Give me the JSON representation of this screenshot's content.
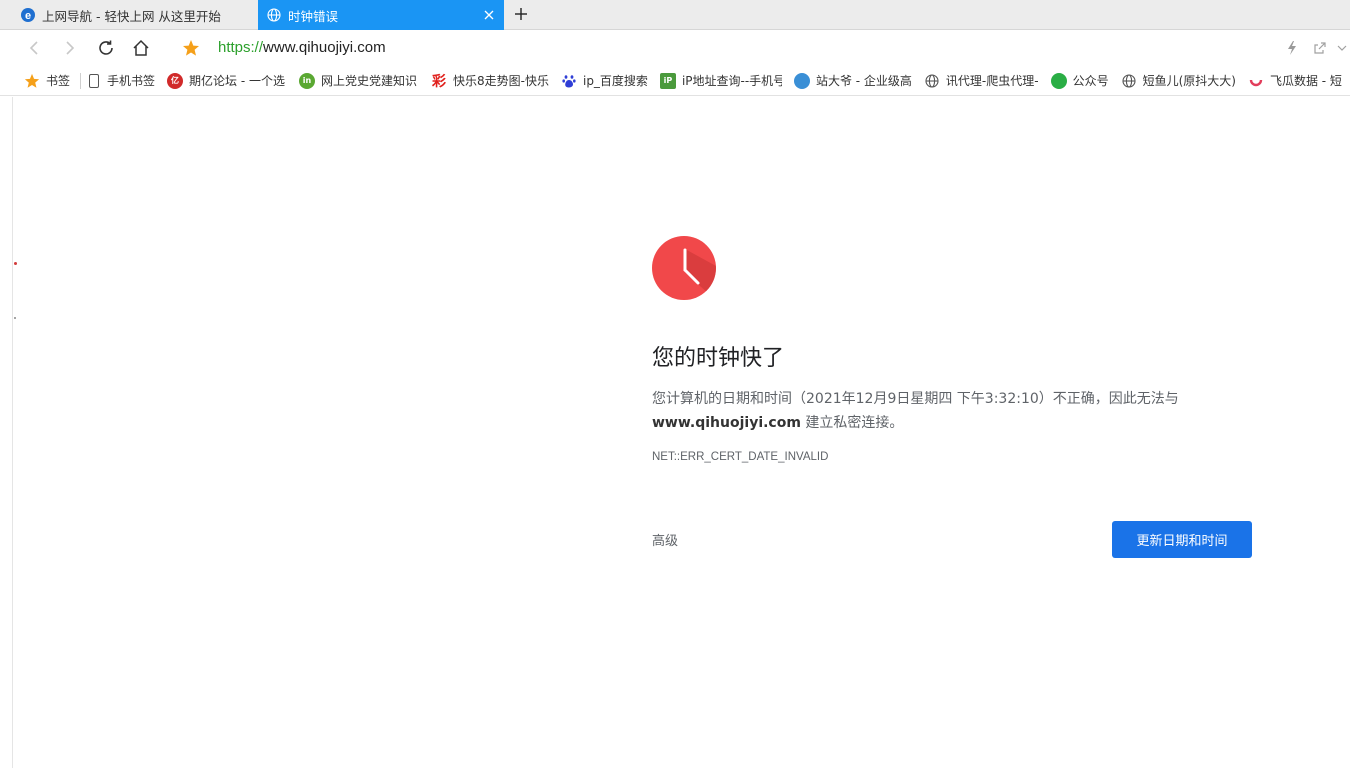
{
  "tabs": [
    {
      "label": "上网导航 - 轻快上网 从这里开始",
      "icon": "ie-icon",
      "active": false
    },
    {
      "label": "时钟错误",
      "icon": "globe-icon",
      "active": true
    }
  ],
  "toolbar": {
    "url_scheme": "https://",
    "url_rest": "www.qihuojiyi.com"
  },
  "bookmarks": {
    "root_label": "书签",
    "items": [
      {
        "label": "手机书签",
        "icon": "phone-icon",
        "color": "#666666"
      },
      {
        "label": "期亿论坛 - 一个选",
        "icon": "qiyi-icon",
        "color": "#d12a2a"
      },
      {
        "label": "网上党史党建知识",
        "icon": "in-icon",
        "color": "#5aa832"
      },
      {
        "label": "快乐8走势图-快乐",
        "icon": "caibao-icon",
        "color": "#e0201c"
      },
      {
        "label": "ip_百度搜索",
        "icon": "baidu-paw-icon",
        "color": "#2f3ed6"
      },
      {
        "label": "iP地址查询--手机号",
        "icon": "ip-map-icon",
        "color": "#4a9a3c"
      },
      {
        "label": "站大爷 - 企业级高",
        "icon": "zdy-icon",
        "color": "#3a8fd6"
      },
      {
        "label": "讯代理-爬虫代理-",
        "icon": "globe-icon",
        "color": "#555555"
      },
      {
        "label": "公众号",
        "icon": "wechat-icon",
        "color": "#2aae45"
      },
      {
        "label": "短鱼儿(原抖大大)",
        "icon": "globe-icon",
        "color": "#555555"
      },
      {
        "label": "飞瓜数据 - 短",
        "icon": "feigua-icon",
        "color": "#e23d5b"
      }
    ]
  },
  "error": {
    "title": "您的时钟快了",
    "desc_part1": "您计算机的日期和时间（2021年12月9日星期四 下午3:32:10）不正确，因此无法与",
    "desc_domain": "www.qihuojiyi.com",
    "desc_part2": "建立私密连接。",
    "code": "NET::ERR_CERT_DATE_INVALID",
    "advanced_label": "高级",
    "primary_button_label": "更新日期和时间",
    "icon_color": "#f1484a"
  }
}
